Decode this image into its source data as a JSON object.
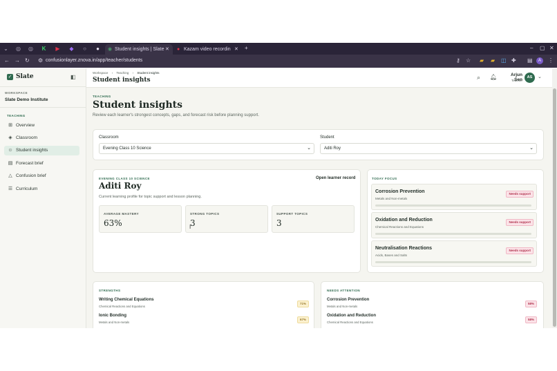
{
  "browser": {
    "tabs": [
      {
        "title": "Student insights | Slate",
        "active": true
      },
      {
        "title": "Kazam video recording",
        "active": false
      }
    ],
    "url": "confusionlayer.znova.in/app/teacher/students",
    "profile_initial": "A"
  },
  "app": {
    "name": "Slate"
  },
  "sidebar": {
    "workspace_label": "WORKSPACE",
    "workspace_name": "Slate Demo Institute",
    "section_label": "TEACHING",
    "items": [
      {
        "label": "Overview",
        "icon": "grid-icon"
      },
      {
        "label": "Classroom",
        "icon": "layers-icon"
      },
      {
        "label": "Student insights",
        "icon": "users-icon",
        "active": true
      },
      {
        "label": "Forecast brief",
        "icon": "clipboard-icon"
      },
      {
        "label": "Confusion brief",
        "icon": "alert-icon"
      },
      {
        "label": "Curriculum",
        "icon": "list-icon"
      }
    ]
  },
  "header": {
    "breadcrumb": [
      "Workspace",
      "Teaching",
      "Student insights"
    ],
    "title": "Student insights",
    "user_name": "Arjun Sen",
    "user_role": "Teacher",
    "user_initials": "AS"
  },
  "page": {
    "eyebrow": "TEACHING",
    "title": "Student insights",
    "subtitle": "Review each learner's strongest concepts, gaps, and forecast risk before planning support."
  },
  "filters": {
    "classroom_label": "Classroom",
    "classroom_value": "Evening Class 10 Science",
    "student_label": "Student",
    "student_value": "Aditi Roy"
  },
  "profile": {
    "class_label": "EVENING CLASS 10 SCIENCE",
    "name": "Aditi Roy",
    "description": "Current learning profile for topic support and lesson planning.",
    "open_record": "Open learner record",
    "stats": [
      {
        "label": "AVERAGE MASTERY",
        "value": "63%"
      },
      {
        "label": "STRONG TOPICS",
        "value": "3"
      },
      {
        "label": "SUPPORT TOPICS",
        "value": "3"
      }
    ]
  },
  "today_focus": {
    "label": "TODAY FOCUS",
    "items": [
      {
        "title": "Corrosion Prevention",
        "subtitle": "Metals and Non-metals",
        "badge": "Needs support"
      },
      {
        "title": "Oxidation and Reduction",
        "subtitle": "Chemical Reactions and Equations",
        "badge": "Needs support"
      },
      {
        "title": "Neutralisation Reactions",
        "subtitle": "Acids, Bases and Salts",
        "badge": "Needs support"
      }
    ]
  },
  "strengths": {
    "label": "STRENGTHS",
    "items": [
      {
        "title": "Writing Chemical Equations",
        "subtitle": "Chemical Reactions and Equations",
        "pct": "71%"
      },
      {
        "title": "Ionic Bonding",
        "subtitle": "Metals and Non-metals",
        "pct": "67%"
      }
    ]
  },
  "needs_attention": {
    "label": "NEEDS ATTENTION",
    "items": [
      {
        "title": "Corrosion Prevention",
        "subtitle": "Metals and Non-metals",
        "pct": "58%"
      },
      {
        "title": "Oxidation and Reduction",
        "subtitle": "Chemical Reactions and Equations",
        "pct": "58%"
      }
    ]
  },
  "colors": {
    "accent": "#2f6b4f",
    "active_nav": "#e1eee6",
    "danger": "#b0324d",
    "warning": "#9a7a2a"
  }
}
